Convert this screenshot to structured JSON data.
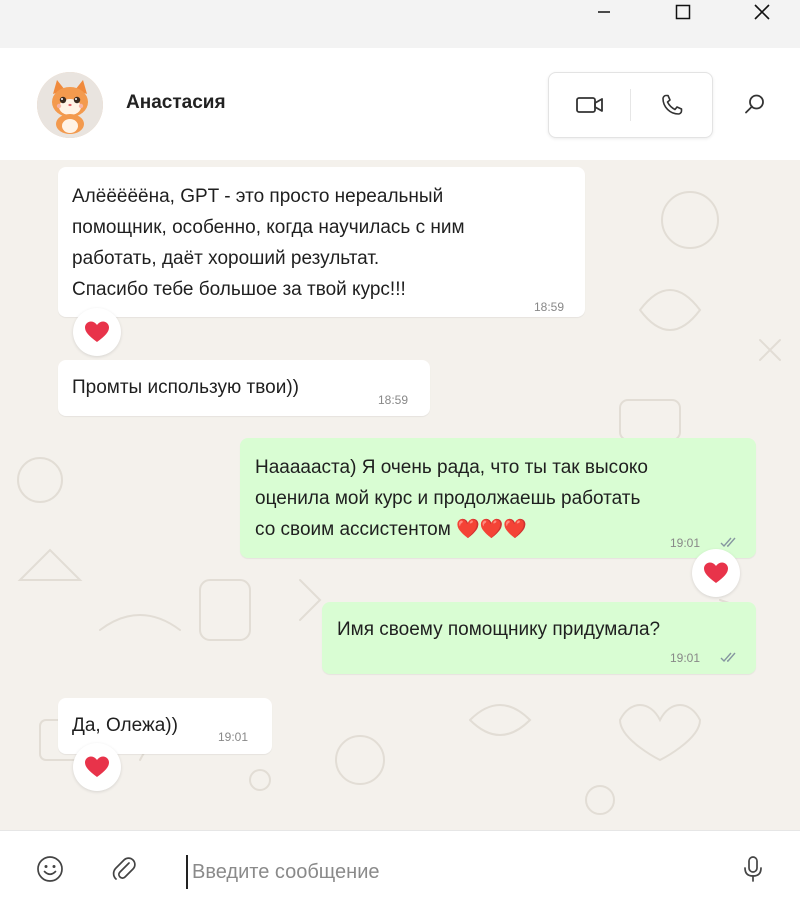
{
  "window": {
    "controls": [
      "minimize",
      "maximize",
      "close"
    ]
  },
  "header": {
    "contact_name": "Анастасия",
    "video_call_icon": "video-camera-icon",
    "voice_call_icon": "phone-icon",
    "search_icon": "search-icon"
  },
  "messages": [
    {
      "direction": "in",
      "text_lines": [
        "Алёёёёёна, GPT - это просто нереальный",
        "помощник, особенно, когда научилась с ним",
        "работать, даёт хороший результат.",
        "Спасибо тебе большое за твой курс!!!"
      ],
      "time": "18:59",
      "reaction": "❤️"
    },
    {
      "direction": "in",
      "text_lines": [
        "Промты использую твои))"
      ],
      "time": "18:59"
    },
    {
      "direction": "out",
      "text_lines": [
        "Наааааста) Я очень рада, что ты так высоко",
        "оценила мой курс и продолжаешь работать",
        "со своим ассистентом ❤️❤️❤️"
      ],
      "time": "19:01",
      "read": true,
      "reaction": "❤️"
    },
    {
      "direction": "out",
      "text_lines": [
        "Имя своему помощнику придумала?"
      ],
      "time": "19:01",
      "read": true
    },
    {
      "direction": "in",
      "text_lines": [
        "Да, Олежа))"
      ],
      "time": "19:01",
      "reaction": "❤️"
    }
  ],
  "composer": {
    "placeholder": "Введите сообщение",
    "emoji_icon": "smiley-icon",
    "attach_icon": "paperclip-icon",
    "mic_icon": "microphone-icon"
  },
  "colors": {
    "incoming_bubble": "#ffffff",
    "outgoing_bubble": "#d9fdd3",
    "chat_background": "#f4f1ec",
    "heart": "#e8334a",
    "read_ticks": "#8696a0"
  }
}
